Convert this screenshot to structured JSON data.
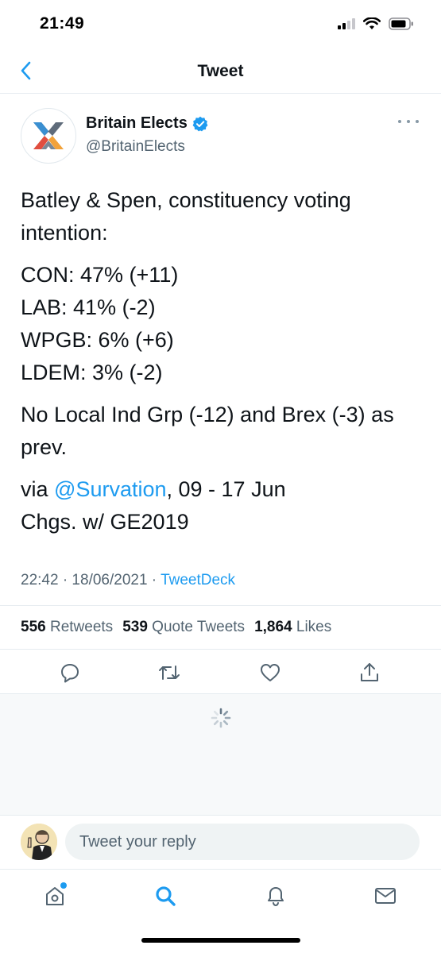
{
  "status_bar": {
    "time": "21:49"
  },
  "header": {
    "title": "Tweet"
  },
  "tweet": {
    "author_name": "Britain Elects",
    "author_handle": "@BritainElects",
    "text_intro": "Batley & Spen, constituency voting intention:",
    "results": [
      "CON: 47% (+11)",
      "LAB: 41% (-2)",
      "WPGB: 6% (+6)",
      "LDEM: 3% (-2)"
    ],
    "note": "No Local Ind Grp (-12) and Brex (-3) as prev.",
    "via_prefix": "via ",
    "via_mention": "@Survation",
    "via_suffix": ", 09 - 17 Jun",
    "changes_note": "Chgs. w/ GE2019",
    "timestamp": "22:42 · 18/06/2021 · ",
    "source": "TweetDeck"
  },
  "stats": {
    "retweets_count": "556",
    "retweets_label": "Retweets",
    "quotes_count": "539",
    "quotes_label": "Quote Tweets",
    "likes_count": "1,864",
    "likes_label": "Likes"
  },
  "reply": {
    "placeholder": "Tweet your reply"
  },
  "colors": {
    "accent": "#1d9bf0",
    "text": "#0f1419",
    "muted": "#536471",
    "divider": "#e6ecf0"
  },
  "icons": {
    "status": [
      "signal-icon",
      "wifi-icon",
      "battery-icon"
    ],
    "actions": [
      "reply-icon",
      "retweet-icon",
      "like-icon",
      "share-icon"
    ],
    "tabs": [
      "home-icon",
      "search-icon",
      "notifications-icon",
      "messages-icon"
    ]
  }
}
